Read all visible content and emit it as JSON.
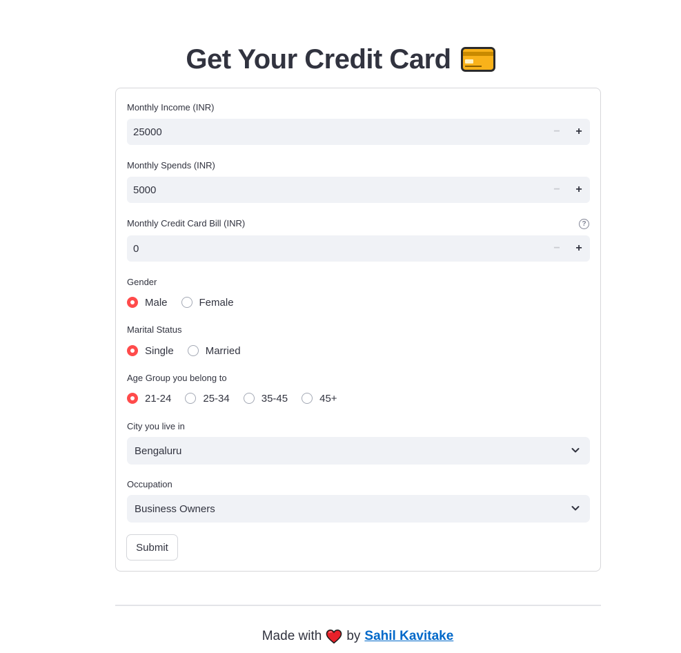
{
  "header": {
    "title": "Get Your Credit Card",
    "icon": "credit-card-icon"
  },
  "form": {
    "monthly_income": {
      "label": "Monthly Income (INR)",
      "value": "25000"
    },
    "monthly_spends": {
      "label": "Monthly Spends (INR)",
      "value": "5000"
    },
    "monthly_bill": {
      "label": "Monthly Credit Card Bill (INR)",
      "value": "0",
      "help_icon": "question-circle-icon"
    },
    "gender": {
      "label": "Gender",
      "options": [
        "Male",
        "Female"
      ],
      "selected": "Male"
    },
    "marital_status": {
      "label": "Marital Status",
      "options": [
        "Single",
        "Married"
      ],
      "selected": "Single"
    },
    "age_group": {
      "label": "Age Group you belong to",
      "options": [
        "21-24",
        "25-34",
        "35-45",
        "45+"
      ],
      "selected": "21-24"
    },
    "city": {
      "label": "City you live in",
      "value": "Bengaluru"
    },
    "occupation": {
      "label": "Occupation",
      "value": "Business Owners"
    },
    "submit_label": "Submit"
  },
  "footer": {
    "made_with": "Made with",
    "by": "by",
    "author": "Sahil Kavitake",
    "heart_icon": "heart-icon"
  },
  "colors": {
    "accent": "#ff4b4b",
    "input_bg": "#f0f2f6",
    "text": "#31333f",
    "link": "#0068c9"
  }
}
